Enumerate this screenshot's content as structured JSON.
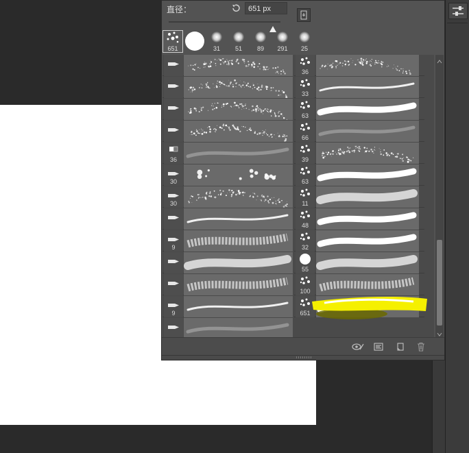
{
  "panel": {
    "diameter_label": "直径：",
    "diameter_value": "651 px",
    "diameter_slider_fraction": 0.93
  },
  "presets": [
    {
      "size": "651",
      "kind": "scatter"
    },
    {
      "size": "",
      "kind": "hard-round"
    },
    {
      "size": "31",
      "kind": "soft"
    },
    {
      "size": "51",
      "kind": "soft"
    },
    {
      "size": "89",
      "kind": "soft"
    },
    {
      "size": "291",
      "kind": "soft"
    },
    {
      "size": "25",
      "kind": "soft"
    }
  ],
  "brush_list": {
    "left": [
      {
        "size": "",
        "icon": "brush-tip-icon"
      },
      {
        "size": "",
        "icon": "brush-tip-icon"
      },
      {
        "size": "",
        "icon": "brush-tip-icon"
      },
      {
        "size": "",
        "icon": "brush-tip-icon"
      },
      {
        "size": "36",
        "icon": "square-tip-icon"
      },
      {
        "size": "30",
        "icon": "brush-tip-icon"
      },
      {
        "size": "30",
        "icon": "brush-tip-icon"
      },
      {
        "size": "",
        "icon": "brush-tip-icon"
      },
      {
        "size": "9",
        "icon": "brush-tip-icon"
      },
      {
        "size": "",
        "icon": "brush-tip-icon"
      },
      {
        "size": "",
        "icon": "brush-tip-icon"
      },
      {
        "size": "9",
        "icon": "brush-tip-icon"
      },
      {
        "size": "",
        "icon": "brush-tip-icon"
      }
    ],
    "right": [
      {
        "size": "36"
      },
      {
        "size": "33"
      },
      {
        "size": "63"
      },
      {
        "size": "66"
      },
      {
        "size": "39"
      },
      {
        "size": "63"
      },
      {
        "size": "11"
      },
      {
        "size": "48"
      },
      {
        "size": "32"
      },
      {
        "size": "55"
      },
      {
        "size": "100"
      },
      {
        "size": "651"
      }
    ]
  },
  "colors": {
    "panel_bg": "#535353",
    "highlight": "#f5f000"
  },
  "footer_icons": [
    "toggle-preview-icon",
    "settings-panel-icon",
    "new-brush-icon",
    "trash-icon"
  ]
}
